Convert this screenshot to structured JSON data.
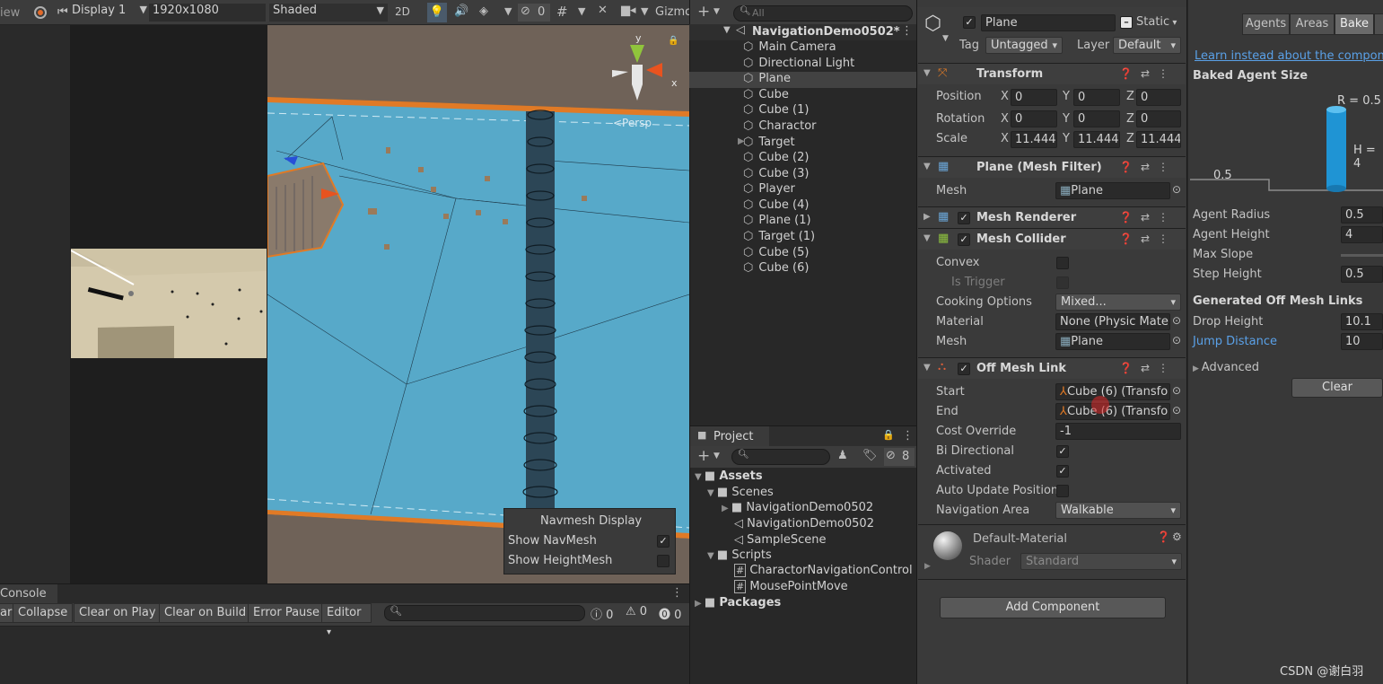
{
  "scene_toolbar": {
    "game_cut": "iew",
    "display": "Display 1",
    "resolution": "1920x1080",
    "shading": "Shaded",
    "mode2d": "2D",
    "hidden_count": "0",
    "gizmos": "Gizmo"
  },
  "scene": {
    "persp": "<Persp",
    "axis_x": "x",
    "axis_y": "y",
    "navmesh_title": "Navmesh Display",
    "show_navmesh": "Show NavMesh",
    "show_heightmesh": "Show HeightMesh"
  },
  "hierarchy": {
    "search_placeholder": "All",
    "scene_name": "NavigationDemo0502*",
    "items": [
      "Main Camera",
      "Directional Light",
      "Plane",
      "Cube",
      "Cube (1)",
      "Charactor",
      "Target",
      "Cube (2)",
      "Cube (3)",
      "Player",
      "Cube (4)",
      "Plane (1)",
      "Target (1)",
      "Cube (5)",
      "Cube (6)"
    ]
  },
  "project": {
    "tab": "Project",
    "hidden_count": "8",
    "assets": "Assets",
    "scenes": "Scenes",
    "folder": "NavigationDemo0502",
    "scene_file": "NavigationDemo0502",
    "sample": "SampleScene",
    "scripts": "Scripts",
    "script1": "CharactorNavigationControl",
    "script2": "MousePointMove",
    "packages": "Packages"
  },
  "console": {
    "tab": "Console",
    "clear_cut": "ar",
    "collapse": "Collapse",
    "clear_on_play": "Clear on Play",
    "clear_on_build": "Clear on Build",
    "error_pause": "Error Pause",
    "editor": "Editor",
    "log_count": "0",
    "warn_count": "0",
    "err_count": "0"
  },
  "inspector": {
    "object_name": "Plane",
    "static": "Static",
    "tag_label": "Tag",
    "tag": "Untagged",
    "layer_label": "Layer",
    "layer": "Default",
    "transform": {
      "title": "Transform",
      "position": "Position",
      "rotation": "Rotation",
      "scale": "Scale",
      "px": "0",
      "py": "0",
      "pz": "0",
      "rx": "0",
      "ry": "0",
      "rz": "0",
      "sx": "11.444",
      "sy": "11.444",
      "sz": "11.444",
      "x": "X",
      "y": "Y",
      "z": "Z"
    },
    "mesh_filter": {
      "title": "Plane (Mesh Filter)",
      "mesh_label": "Mesh",
      "mesh": "Plane"
    },
    "mesh_renderer": {
      "title": "Mesh Renderer"
    },
    "mesh_collider": {
      "title": "Mesh Collider",
      "convex": "Convex",
      "is_trigger": "Is Trigger",
      "cooking": "Cooking Options",
      "cooking_val": "Mixed...",
      "material": "Material",
      "material_val": "None (Physic Mate",
      "mesh_label": "Mesh",
      "mesh": "Plane"
    },
    "off_mesh_link": {
      "title": "Off Mesh Link",
      "start": "Start",
      "start_val": "Cube (6) (Transfo",
      "end": "End",
      "end_val": "Cube (6) (Transfo",
      "cost": "Cost Override",
      "cost_val": "-1",
      "bidir": "Bi Directional",
      "activated": "Activated",
      "auto_update": "Auto Update Position",
      "nav_area": "Navigation Area",
      "nav_area_val": "Walkable"
    },
    "material": {
      "name": "Default-Material",
      "shader_label": "Shader",
      "shader": "Standard"
    },
    "add_component": "Add Component"
  },
  "navigation": {
    "tabs": [
      "Agents",
      "Areas",
      "Bake"
    ],
    "learn": "Learn instead about the component",
    "baked_size": "Baked Agent Size",
    "r_label": "R = 0.5",
    "h_label": "H = 4",
    "step_label": "0.5",
    "agent_radius": "Agent Radius",
    "agent_radius_val": "0.5",
    "agent_height": "Agent Height",
    "agent_height_val": "4",
    "max_slope": "Max Slope",
    "step_height": "Step Height",
    "step_height_val": "0.5",
    "gen_links": "Generated Off Mesh Links",
    "drop_height": "Drop Height",
    "drop_height_val": "10.1",
    "jump_distance": "Jump Distance",
    "jump_distance_val": "10",
    "advanced": "Advanced",
    "clear": "Clear"
  },
  "watermark": "CSDN @谢白羽",
  "colors": {
    "nav_blue": "#56a8c8",
    "accent_orange": "#e07a26",
    "link_blue": "#5aa1e8",
    "cylinder_blue": "#1f94d4"
  }
}
